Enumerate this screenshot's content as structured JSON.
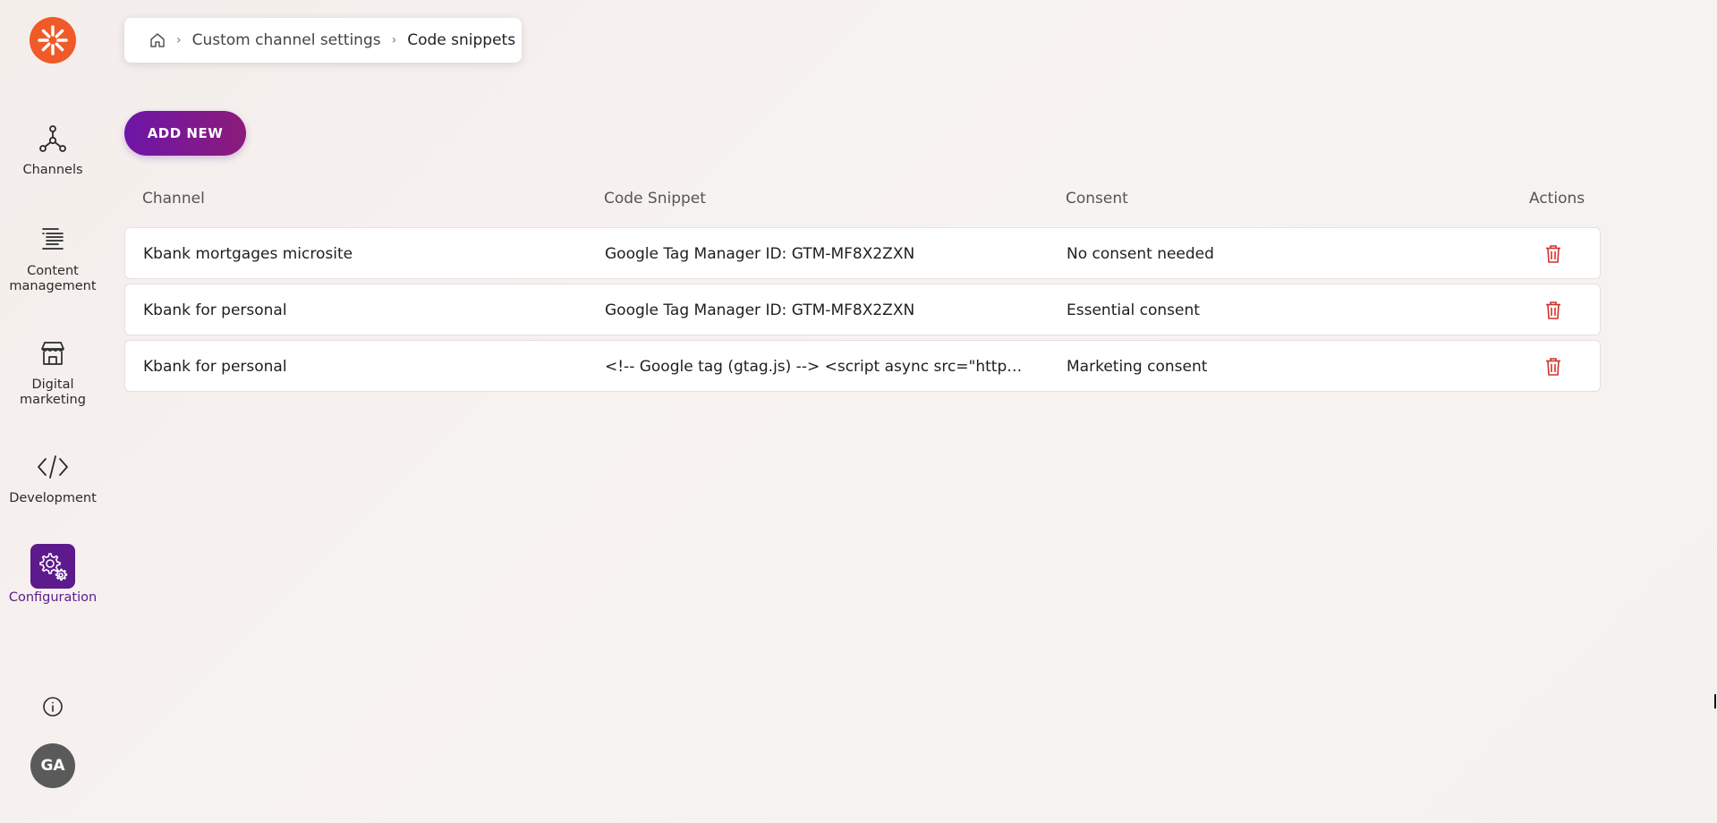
{
  "sidebar": {
    "logo_icon": "brand-logo-icon",
    "items": [
      {
        "label": "Channels",
        "icon": "channels-icon"
      },
      {
        "label": "Content management",
        "icon": "content-icon"
      },
      {
        "label": "Digital marketing",
        "icon": "store-icon"
      },
      {
        "label": "Development",
        "icon": "code-icon"
      },
      {
        "label": "Configuration",
        "icon": "gear-icon",
        "active": true
      }
    ],
    "info_icon": "info-icon",
    "avatar_initials": "GA"
  },
  "breadcrumb": {
    "home_icon": "home-icon",
    "items": [
      "Custom channel settings",
      "Code snippets"
    ]
  },
  "toolbar": {
    "add_label": "ADD NEW"
  },
  "table": {
    "columns": [
      "Channel",
      "Code Snippet",
      "Consent",
      "Actions"
    ],
    "rows": [
      {
        "channel": "Kbank mortgages microsite",
        "snippet": "Google Tag Manager ID: GTM-MF8X2ZXN",
        "consent": "No consent needed"
      },
      {
        "channel": "Kbank for personal",
        "snippet": "Google Tag Manager ID: GTM-MF8X2ZXN",
        "consent": "Essential consent"
      },
      {
        "channel": "Kbank for personal",
        "snippet": "<!-- Google tag (gtag.js) --> <script async src=\"https://ww...",
        "consent": "Marketing consent"
      }
    ]
  },
  "colors": {
    "brand_orange": "#f05a28",
    "accent_purple": "#5c1a8c",
    "delete_red": "#d0312d"
  }
}
